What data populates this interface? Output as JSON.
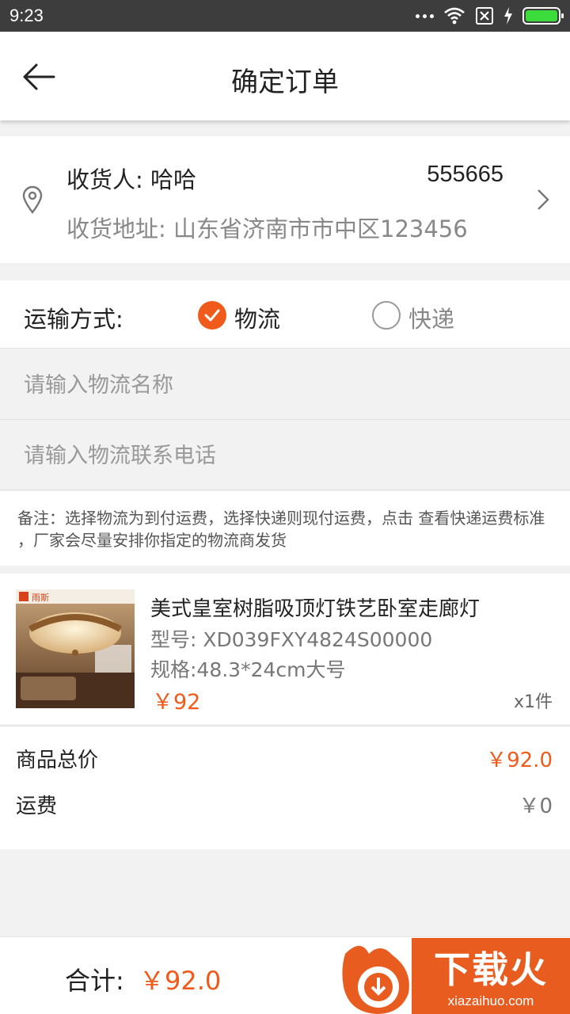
{
  "status_bar": {
    "time": "9:23"
  },
  "header": {
    "title": "确定订单"
  },
  "address": {
    "recipient": "收货人: 哈哈",
    "phone": "555665",
    "address": "收货地址: 山东省济南市市中区123456"
  },
  "shipping": {
    "label": "运输方式:",
    "options": [
      {
        "label": "物流",
        "selected": true
      },
      {
        "label": "快递",
        "selected": false
      }
    ]
  },
  "inputs": {
    "logistics_name_placeholder": "请输入物流名称",
    "logistics_phone_placeholder": "请输入物流联系电话"
  },
  "note": "备注：选择物流为到付运费，选择快递则现付运费，点击 查看快递运费标准 ，厂家会尽量安排你指定的物流商发货",
  "product": {
    "name": "美式皇室树脂吸顶灯铁艺卧室走廊灯",
    "model": "型号: XD039FXY4824S00000",
    "spec": "规格:48.3*24cm大号",
    "price": "￥92",
    "quantity": "x1件",
    "brand_logo_text": "雨斯"
  },
  "summary": {
    "goods_total_label": "商品总价",
    "goods_total_value": "￥92.0",
    "freight_label": "运费",
    "freight_value": "￥0"
  },
  "footer": {
    "total_label": "合计:",
    "total_value": "￥92.0"
  },
  "watermark": {
    "brand": "下载火",
    "url": "xiazaihuo.com"
  },
  "colors": {
    "accent": "#f05a1a",
    "status_bar": "#3d3d3d",
    "background": "#f2f2f2"
  }
}
